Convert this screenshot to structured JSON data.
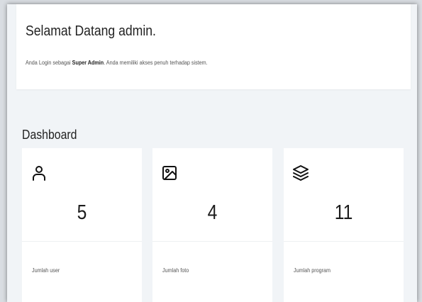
{
  "welcome": {
    "title": "Selamat Datang admin.",
    "sub_prefix": "Anda Login sebagai ",
    "role": "Super Admin",
    "sub_suffix": ". Anda memiliki akses penuh terhadap sistem."
  },
  "dashboard": {
    "title": "Dashboard",
    "cards": [
      {
        "icon": "user-icon",
        "value": "5",
        "label": "Jumlah user"
      },
      {
        "icon": "image-icon",
        "value": "4",
        "label": "Jumlah foto"
      },
      {
        "icon": "layers-icon",
        "value": "11",
        "label": "Jumlah program"
      }
    ]
  },
  "colors": {
    "background": "#f1f4f7",
    "card": "#ffffff",
    "text": "#222222",
    "muted": "#555555"
  }
}
